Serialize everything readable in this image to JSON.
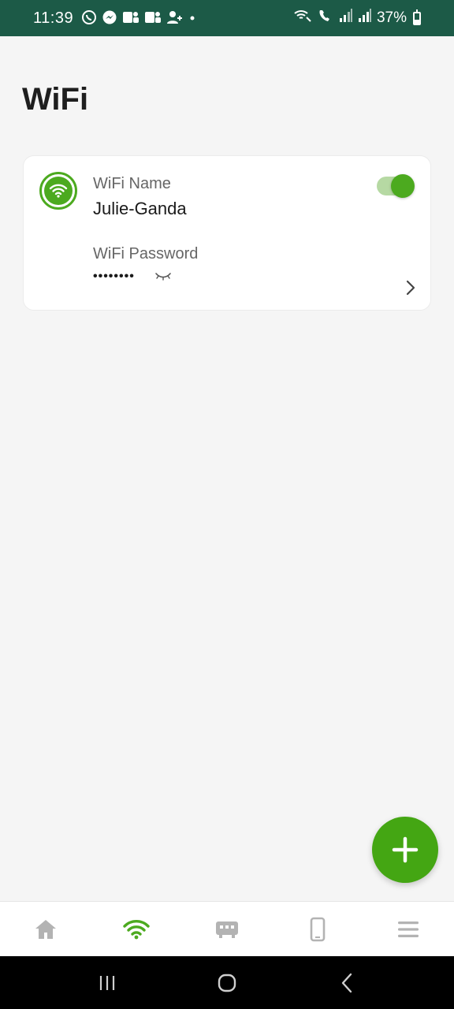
{
  "status_bar": {
    "time": "11:39",
    "battery_text": "37%",
    "battery_level": 0.37,
    "left_icons": [
      "viber-icon",
      "messenger-icon",
      "teams-icon",
      "teams-icon",
      "contact-add-icon",
      "dot-icon"
    ],
    "right_icons": [
      "wifi-calling-icon",
      "volte-icon",
      "signal-icon",
      "signal-icon",
      "battery-icon"
    ]
  },
  "page": {
    "title": "WiFi"
  },
  "wifi_card": {
    "icon": "wifi-icon",
    "name_label": "WiFi Name",
    "name_value": "Julie-Ganda",
    "password_label": "WiFi Password",
    "password_value": "••••••••",
    "enabled": true,
    "accent_color": "#4caa1f"
  },
  "fab": {
    "icon": "plus-icon",
    "color": "#44a613"
  },
  "tab_bar": {
    "active_index": 1,
    "active_color": "#4caa1f",
    "inactive_color": "#b3b3b3",
    "tabs": [
      {
        "icon": "home-icon"
      },
      {
        "icon": "wifi-icon"
      },
      {
        "icon": "router-icon"
      },
      {
        "icon": "phone-icon"
      },
      {
        "icon": "menu-icon"
      }
    ]
  },
  "nav_bar": {
    "buttons": [
      "recents-icon",
      "home-circle-icon",
      "back-icon"
    ]
  }
}
